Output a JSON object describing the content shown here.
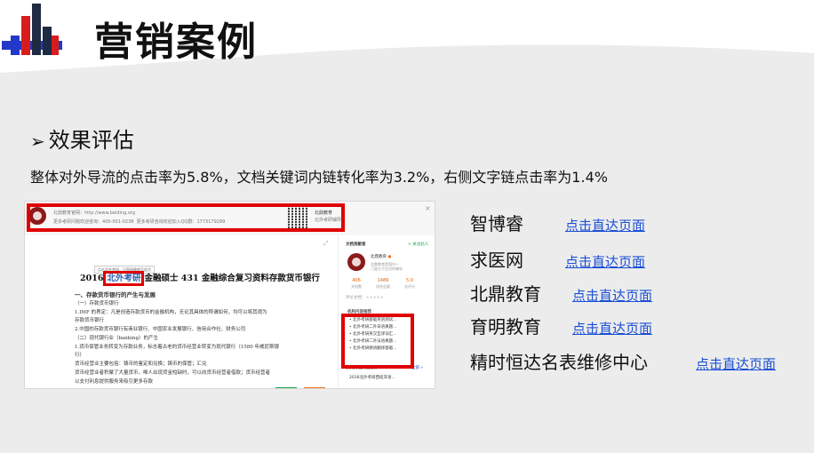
{
  "slide": {
    "title": "营销案例",
    "section_heading": "效果评估",
    "summary": "整体对外导流的点击率为5.8%，文档关键词内链转化率为3.2%，右侧文字链点击率为1.4%"
  },
  "screenshot": {
    "header": {
      "brand": "北鼎教育官网：",
      "url": "http://www.beiding.org",
      "line2_label": "更多考研问题欢迎咨询：",
      "phone": "400-001-0238",
      "line2_qq_label": "更多考研咨询欢迎加入QQ群：",
      "qq": "1773179289",
      "right_name": "北鼎教育",
      "right_sub": "北外考研辅导"
    },
    "tooltip": "点击北外考研，可直接跳转至此页",
    "doc_title_pre": "2016",
    "doc_title_link": "北外考研",
    "doc_title_post": "金融硕士 431 金融综合复习资料存款货币银行",
    "doc_lines": [
      "一、存款货币银行的产生与发展",
      "（一）存款货币银行",
      "1.IMF 的界定：凡是创造存款货币的金融机构，无论其具体的称谓如何，均可以将其视为",
      "存款货币银行",
      "2.中国的存款货币银行有商业银行、中国农业发展银行、信用合作社、财务公司",
      "（二）现代银行业（banking）的产生",
      "1.货币保管业务转变为存款业务，标志着古老的货币经营业转变为现代银行（1580 年威尼斯银",
      "行）",
      "货币经营业主要包括：铸币的鉴定和兑换；铸币的保管；汇兑",
      "货币经营业者积聚了大量货币，唯人出现货金短缺时，可以向货币经营者借款；货币经营者",
      "以支付利息提供服务来吸引更多存款"
    ],
    "side": {
      "section": "文档贡献者",
      "follow": "+ 关注此人",
      "name": "北鼎教育",
      "desc": "北鼎教育是国内一\n门面分子比对的辅导",
      "stats": [
        {
          "value": "406",
          "label": "文档数"
        },
        {
          "value": "1489",
          "label": "浏览总量"
        },
        {
          "value": "5.0",
          "label": "总评分"
        }
      ],
      "rating_label": "评价文档：",
      "rec_title": "机构内容推荐",
      "rec_items": [
        "北外考研基础英语测试...",
        "北外考研二外日语真题...",
        "北外考研英汉互译词汇...",
        "北外考研二外法语真题...",
        "北外考研德语翻译基础..."
      ],
      "more_title": "机构其他文档推荐",
      "more_link": "全部 »",
      "bottom_item": "2016北外考研西班牙语..."
    }
  },
  "links": [
    {
      "name": "智博睿",
      "link": "点击直达页面"
    },
    {
      "name": "求医网",
      "link": "点击直达页面"
    },
    {
      "name": "北鼎教育",
      "link": "点击直达页面"
    },
    {
      "name": "育明教育",
      "link": "点击直达页面"
    },
    {
      "name": "精时恒达名表维修中心",
      "link": "点击直达页面"
    }
  ],
  "colors": {
    "accent_red": "#e00000",
    "link_blue": "#1a4fd6",
    "logo_navy": "#1f2a44",
    "logo_blue": "#2438c8",
    "logo_red": "#d81c1c"
  }
}
